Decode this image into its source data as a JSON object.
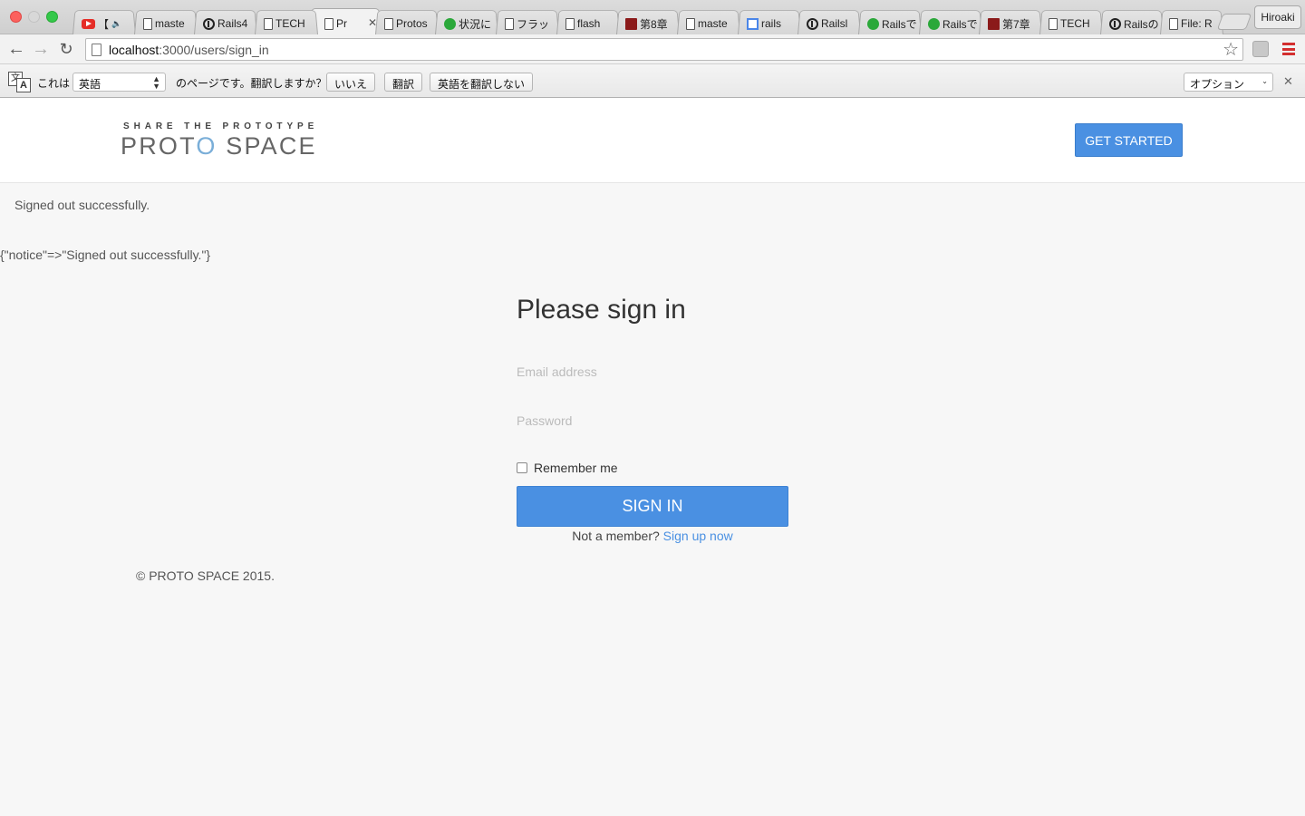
{
  "browser": {
    "tabs": [
      {
        "title": "【",
        "icon": "youtube-icon",
        "audio": true
      },
      {
        "title": "maste",
        "icon": "document-icon"
      },
      {
        "title": "Rails4",
        "icon": "circle-info-icon"
      },
      {
        "title": "TECH",
        "icon": "document-icon"
      },
      {
        "title": "Pr",
        "icon": "document-icon",
        "active": true
      },
      {
        "title": "Protos",
        "icon": "document-icon"
      },
      {
        "title": "状況に",
        "icon": "green-bubble-icon"
      },
      {
        "title": "フラッ",
        "icon": "document-icon"
      },
      {
        "title": "flash",
        "icon": "document-icon"
      },
      {
        "title": "第8章",
        "icon": "book-icon"
      },
      {
        "title": "maste",
        "icon": "document-icon"
      },
      {
        "title": "rails",
        "icon": "window-icon"
      },
      {
        "title": "Railsl",
        "icon": "circle-info-icon"
      },
      {
        "title": "Railsで",
        "icon": "green-bubble-icon"
      },
      {
        "title": "Railsで",
        "icon": "green-bubble-icon"
      },
      {
        "title": "第7章",
        "icon": "book-icon"
      },
      {
        "title": "TECH",
        "icon": "document-icon"
      },
      {
        "title": "Railsの",
        "icon": "circle-info-icon"
      },
      {
        "title": "File: R",
        "icon": "document-icon"
      }
    ],
    "profile_name": "Hiroaki",
    "url_host": "localhost",
    "url_path": ":3000/users/sign_in"
  },
  "translate_bar": {
    "prefix": "これは",
    "language": "英語",
    "question": "のページです。翻訳しますか？",
    "no_label": "いいえ",
    "translate_label": "翻訳",
    "never_label": "英語を翻訳しない",
    "options_label": "オプション"
  },
  "site": {
    "tagline": "SHARE THE PROTOTYPE",
    "logo_part1": "PROTO",
    "logo_accent": "",
    "logo_part2": " SPACE",
    "get_started": "GET STARTED",
    "flash_notice": "Signed out successfully.",
    "flash_debug": "{\"notice\"=>\"Signed out successfully.\"}",
    "signin": {
      "title": "Please sign in",
      "email_placeholder": "Email address",
      "password_placeholder": "Password",
      "remember_label": "Remember me",
      "submit_label": "SIGN IN",
      "not_member": "Not a member?",
      "signup_link": "Sign up now"
    },
    "footer": "© PROTO SPACE 2015."
  },
  "colors": {
    "primary_button": "#4a90e2",
    "page_background": "#f7f7f7",
    "logo_accent": "#7aaed8"
  }
}
